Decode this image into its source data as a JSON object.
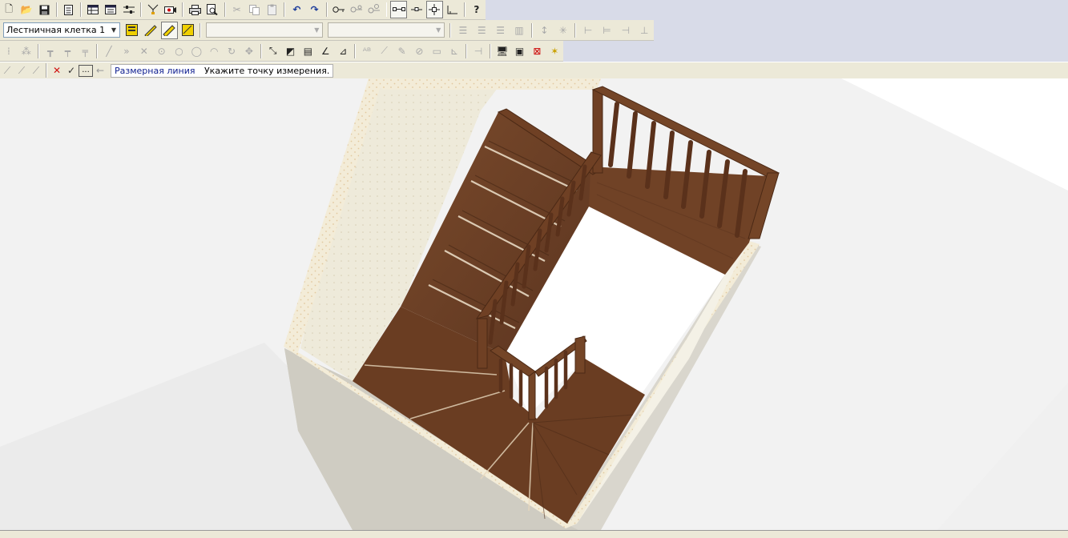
{
  "toolbar_file": {
    "icons": [
      "new-file-icon",
      "open-folder-icon",
      "save-disk-icon",
      "properties-icon",
      "table-icon",
      "table-list-icon",
      "settings-sliders-icon",
      "filter-tools-icon",
      "render-view-icon",
      "print-icon",
      "print-preview-icon",
      "cut-icon",
      "copy-icon",
      "paste-icon",
      "undo-icon",
      "redo-icon",
      "key-icon",
      "key-settings-icon",
      "key-group-icon",
      "snap-link-icon",
      "snap-point-icon",
      "snap-crosshair-icon",
      "snap-angle-icon",
      "help-icon"
    ]
  },
  "toolbar_layer": {
    "layer_select": {
      "value": "Лестничная клетка 1"
    },
    "combo_a": {
      "value": ""
    },
    "combo_b": {
      "value": ""
    }
  },
  "statusbar": {
    "mode_label": "Размерная линия",
    "prompt": "Укажите точку измерения.",
    "ellipsis_label": "..."
  }
}
